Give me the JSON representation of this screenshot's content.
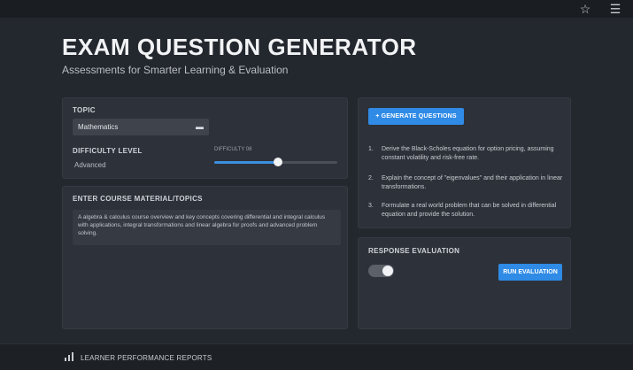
{
  "topbar": {
    "star_icon": "star-icon",
    "menu_icon": "hamburger-menu-icon"
  },
  "header": {
    "title": "EXAM QUESTION GENERATOR",
    "subtitle": "Assessments for Smarter Learning & Evaluation"
  },
  "settings": {
    "topic_label": "TOPIC",
    "topic_value": "Mathematics",
    "difficulty_label": "DIFFICULTY LEVEL",
    "difficulty_value": "Advanced",
    "slider_caption": "DIFFICULTY 08",
    "slider_fraction": 0.52
  },
  "material": {
    "label": "ENTER COURSE MATERIAL/TOPICS",
    "text": "A algebra & calculus course overview and key concepts covering differential and integral calculus with applications, integral transformations and linear algebra for proofs and advanced problem solving."
  },
  "questions": {
    "generate_label": "+ GENERATE QUESTIONS",
    "items": [
      {
        "num": "1.",
        "text": "Derive the Black-Scholes equation for option pricing, assuming constant volatility and risk-free rate."
      },
      {
        "num": "2.",
        "text": "Explain the concept of \"eigenvalues\" and their application in linear transformations."
      },
      {
        "num": "3.",
        "text": "Formulate a real world problem that can be solved in differential equation and provide the solution."
      }
    ]
  },
  "evaluation": {
    "label": "RESPONSE EVALUATION",
    "toggle_on": true,
    "run_label": "RUN EVALUATION"
  },
  "footer": {
    "label": "LEARNER PERFORMANCE REPORTS",
    "icon": "bar-chart-icon"
  },
  "colors": {
    "accent": "#2f8be6",
    "background": "#23272e",
    "panel": "#2d3139"
  }
}
